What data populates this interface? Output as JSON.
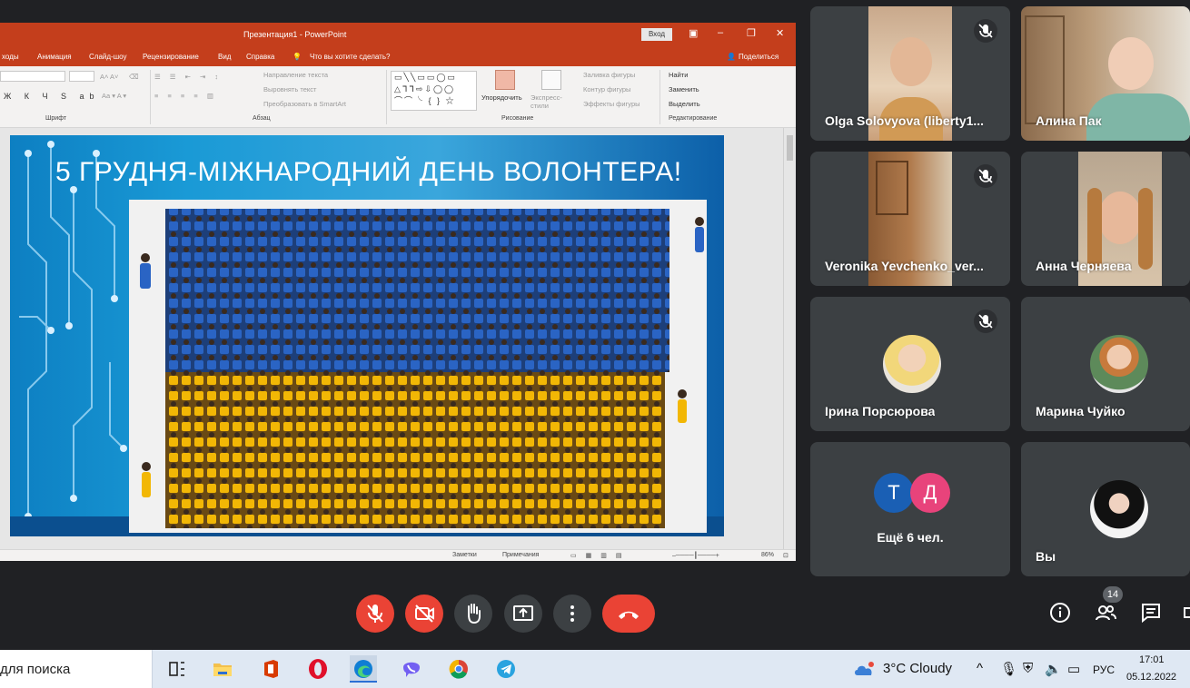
{
  "powerpoint": {
    "doc_title": "Презентация1 - PowerPoint",
    "signin_label": "Вход",
    "tabs": [
      "ходы",
      "Анимация",
      "Слайд-шоу",
      "Рецензирование",
      "Вид",
      "Справка"
    ],
    "tell_me": "Что вы хотите сделать?",
    "share": "Поделиться",
    "groups": {
      "font": "Шрифт",
      "paragraph": "Абзац",
      "drawing": "Рисование",
      "editing": "Редактирование"
    },
    "commands": {
      "text_direction": "Направление текста",
      "align_text": "Выровнять текст",
      "smartart": "Преобразовать в SmartArt",
      "arrange": "Упорядочить",
      "quick_styles": "Экспресс-стили",
      "shape_fill": "Заливка фигуры",
      "shape_outline": "Контур фигуры",
      "shape_effects": "Эффекты фигуры",
      "find": "Найти",
      "replace": "Заменить",
      "select": "Выделить"
    },
    "slide_title": "5 ГРУДНЯ-МІЖНАРОДНИЙ ДЕНЬ ВОЛОНТЕРА!",
    "status": {
      "notes": "Заметки",
      "comments": "Примечания",
      "zoom": "86%"
    }
  },
  "participants": [
    {
      "name": "Olga Solovyova (liberty1..."
    },
    {
      "name": "Алина Пак"
    },
    {
      "name": "Veronika Yevchenko_ver..."
    },
    {
      "name": "Анна Черняева"
    },
    {
      "name": "Ірина Порсюрова"
    },
    {
      "name": "Марина Чуйко"
    },
    {
      "name": "Ещё 6 чел.",
      "initials": [
        "Т",
        "Д"
      ]
    },
    {
      "name": "Вы"
    }
  ],
  "controls": {
    "people_count": "14"
  },
  "taskbar": {
    "search": "для поиска",
    "weather": "3°C  Cloudy",
    "language": "РУС",
    "time": "17:01",
    "date": "05.12.2022"
  },
  "colors": {
    "meet_bg": "#202124",
    "tile_bg": "#3c4043",
    "end_call": "#ea4335",
    "ppt_accent": "#c43e1c",
    "ukraine_blue": "#2a64c4",
    "ukraine_yellow": "#f5c400",
    "avatar_t": "#1a5fb4",
    "avatar_d": "#e8437b"
  }
}
